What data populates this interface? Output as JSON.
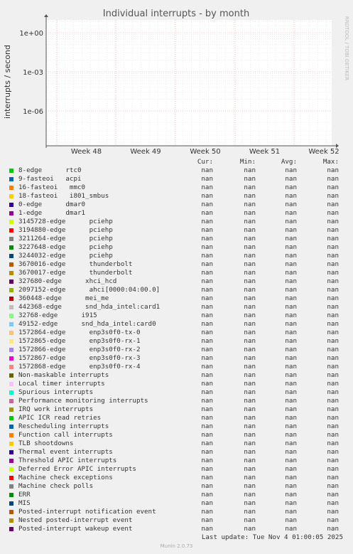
{
  "chart_data": {
    "type": "line",
    "title": "Individual interrupts - by month",
    "ylabel": "interrupts / second",
    "xlabel": "",
    "y_scale": "log",
    "y_ticks": [
      "1e+00",
      "1e-03",
      "1e-06"
    ],
    "x_ticks": [
      "Week 48",
      "Week 49",
      "Week 50",
      "Week 51",
      "Week 52"
    ],
    "grid": true,
    "series_values": "nan"
  },
  "side_label": "RRDTOOL / TOBI OETIKER",
  "legend": {
    "headers": [
      "Cur:",
      "Min:",
      "Avg:",
      "Max:"
    ],
    "items": [
      {
        "name": "8-edge      rtc0",
        "color": "#00cc00",
        "cur": "nan",
        "min": "nan",
        "avg": "nan",
        "max": "nan"
      },
      {
        "name": "9-fasteoi   acpi",
        "color": "#0066b3",
        "cur": "nan",
        "min": "nan",
        "avg": "nan",
        "max": "nan"
      },
      {
        "name": "16-fasteoi   mmc0",
        "color": "#ff8000",
        "cur": "nan",
        "min": "nan",
        "avg": "nan",
        "max": "nan"
      },
      {
        "name": "18-fasteoi   i801_smbus",
        "color": "#ffcc00",
        "cur": "nan",
        "min": "nan",
        "avg": "nan",
        "max": "nan"
      },
      {
        "name": "0-edge      dmar0",
        "color": "#330099",
        "cur": "nan",
        "min": "nan",
        "avg": "nan",
        "max": "nan"
      },
      {
        "name": "1-edge      dmar1",
        "color": "#990099",
        "cur": "nan",
        "min": "nan",
        "avg": "nan",
        "max": "nan"
      },
      {
        "name": "3145728-edge      pciehp",
        "color": "#ccff00",
        "cur": "nan",
        "min": "nan",
        "avg": "nan",
        "max": "nan"
      },
      {
        "name": "3194880-edge      pciehp",
        "color": "#ff0000",
        "cur": "nan",
        "min": "nan",
        "avg": "nan",
        "max": "nan"
      },
      {
        "name": "3211264-edge      pciehp",
        "color": "#808080",
        "cur": "nan",
        "min": "nan",
        "avg": "nan",
        "max": "nan"
      },
      {
        "name": "3227648-edge      pciehp",
        "color": "#008f00",
        "cur": "nan",
        "min": "nan",
        "avg": "nan",
        "max": "nan"
      },
      {
        "name": "3244032-edge      pciehp",
        "color": "#00487d",
        "cur": "nan",
        "min": "nan",
        "avg": "nan",
        "max": "nan"
      },
      {
        "name": "3670016-edge      thunderbolt",
        "color": "#b35a00",
        "cur": "nan",
        "min": "nan",
        "avg": "nan",
        "max": "nan"
      },
      {
        "name": "3670017-edge      thunderbolt",
        "color": "#b38f00",
        "cur": "nan",
        "min": "nan",
        "avg": "nan",
        "max": "nan"
      },
      {
        "name": "327680-edge      xhci_hcd",
        "color": "#6b006b",
        "cur": "nan",
        "min": "nan",
        "avg": "nan",
        "max": "nan"
      },
      {
        "name": "2097152-edge      ahci[0000:04:00.0]",
        "color": "#8fb300",
        "cur": "nan",
        "min": "nan",
        "avg": "nan",
        "max": "nan"
      },
      {
        "name": "360448-edge      mei_me",
        "color": "#b30000",
        "cur": "nan",
        "min": "nan",
        "avg": "nan",
        "max": "nan"
      },
      {
        "name": "442368-edge      snd_hda_intel:card1",
        "color": "#bebebe",
        "cur": "nan",
        "min": "nan",
        "avg": "nan",
        "max": "nan"
      },
      {
        "name": "32768-edge      i915",
        "color": "#80ff80",
        "cur": "nan",
        "min": "nan",
        "avg": "nan",
        "max": "nan"
      },
      {
        "name": "49152-edge      snd_hda_intel:card0",
        "color": "#80c9ff",
        "cur": "nan",
        "min": "nan",
        "avg": "nan",
        "max": "nan"
      },
      {
        "name": "1572864-edge      enp3s0f0-tx-0",
        "color": "#ffc080",
        "cur": "nan",
        "min": "nan",
        "avg": "nan",
        "max": "nan"
      },
      {
        "name": "1572865-edge      enp3s0f0-rx-1",
        "color": "#ffe680",
        "cur": "nan",
        "min": "nan",
        "avg": "nan",
        "max": "nan"
      },
      {
        "name": "1572866-edge      enp3s0f0-rx-2",
        "color": "#aa80ff",
        "cur": "nan",
        "min": "nan",
        "avg": "nan",
        "max": "nan"
      },
      {
        "name": "1572867-edge      enp3s0f0-rx-3",
        "color": "#ee00cc",
        "cur": "nan",
        "min": "nan",
        "avg": "nan",
        "max": "nan"
      },
      {
        "name": "1572868-edge      enp3s0f0-rx-4",
        "color": "#ff8080",
        "cur": "nan",
        "min": "nan",
        "avg": "nan",
        "max": "nan"
      },
      {
        "name": "Non-maskable interrupts",
        "color": "#666600",
        "cur": "nan",
        "min": "nan",
        "avg": "nan",
        "max": "nan"
      },
      {
        "name": "Local timer interrupts",
        "color": "#ffbfff",
        "cur": "nan",
        "min": "nan",
        "avg": "nan",
        "max": "nan"
      },
      {
        "name": "Spurious interrupts",
        "color": "#00ffcc",
        "cur": "nan",
        "min": "nan",
        "avg": "nan",
        "max": "nan"
      },
      {
        "name": "Performance monitoring interrupts",
        "color": "#cc6699",
        "cur": "nan",
        "min": "nan",
        "avg": "nan",
        "max": "nan"
      },
      {
        "name": "IRQ work interrupts",
        "color": "#999900",
        "cur": "nan",
        "min": "nan",
        "avg": "nan",
        "max": "nan"
      },
      {
        "name": "APIC ICR read retries",
        "color": "#00cc00",
        "cur": "nan",
        "min": "nan",
        "avg": "nan",
        "max": "nan"
      },
      {
        "name": "Rescheduling interrupts",
        "color": "#0066b3",
        "cur": "nan",
        "min": "nan",
        "avg": "nan",
        "max": "nan"
      },
      {
        "name": "Function call interrupts",
        "color": "#ff8000",
        "cur": "nan",
        "min": "nan",
        "avg": "nan",
        "max": "nan"
      },
      {
        "name": "TLB shootdowns",
        "color": "#ffcc00",
        "cur": "nan",
        "min": "nan",
        "avg": "nan",
        "max": "nan"
      },
      {
        "name": "Thermal event interrupts",
        "color": "#330099",
        "cur": "nan",
        "min": "nan",
        "avg": "nan",
        "max": "nan"
      },
      {
        "name": "Threshold APIC interrupts",
        "color": "#990099",
        "cur": "nan",
        "min": "nan",
        "avg": "nan",
        "max": "nan"
      },
      {
        "name": "Deferred Error APIC interrupts",
        "color": "#ccff00",
        "cur": "nan",
        "min": "nan",
        "avg": "nan",
        "max": "nan"
      },
      {
        "name": "Machine check exceptions",
        "color": "#ff0000",
        "cur": "nan",
        "min": "nan",
        "avg": "nan",
        "max": "nan"
      },
      {
        "name": "Machine check polls",
        "color": "#808080",
        "cur": "nan",
        "min": "nan",
        "avg": "nan",
        "max": "nan"
      },
      {
        "name": "ERR",
        "color": "#008f00",
        "cur": "nan",
        "min": "nan",
        "avg": "nan",
        "max": "nan"
      },
      {
        "name": "MIS",
        "color": "#00487d",
        "cur": "nan",
        "min": "nan",
        "avg": "nan",
        "max": "nan"
      },
      {
        "name": "Posted-interrupt notification event",
        "color": "#b35a00",
        "cur": "nan",
        "min": "nan",
        "avg": "nan",
        "max": "nan"
      },
      {
        "name": "Nested posted-interrupt event",
        "color": "#b38f00",
        "cur": "nan",
        "min": "nan",
        "avg": "nan",
        "max": "nan"
      },
      {
        "name": "Posted-interrupt wakeup event",
        "color": "#6b006b",
        "cur": "nan",
        "min": "nan",
        "avg": "nan",
        "max": "nan"
      }
    ]
  },
  "footer": {
    "last_update": "Last update: Tue Nov  4 01:00:05 2025",
    "version": "Munin 2.0.73"
  }
}
